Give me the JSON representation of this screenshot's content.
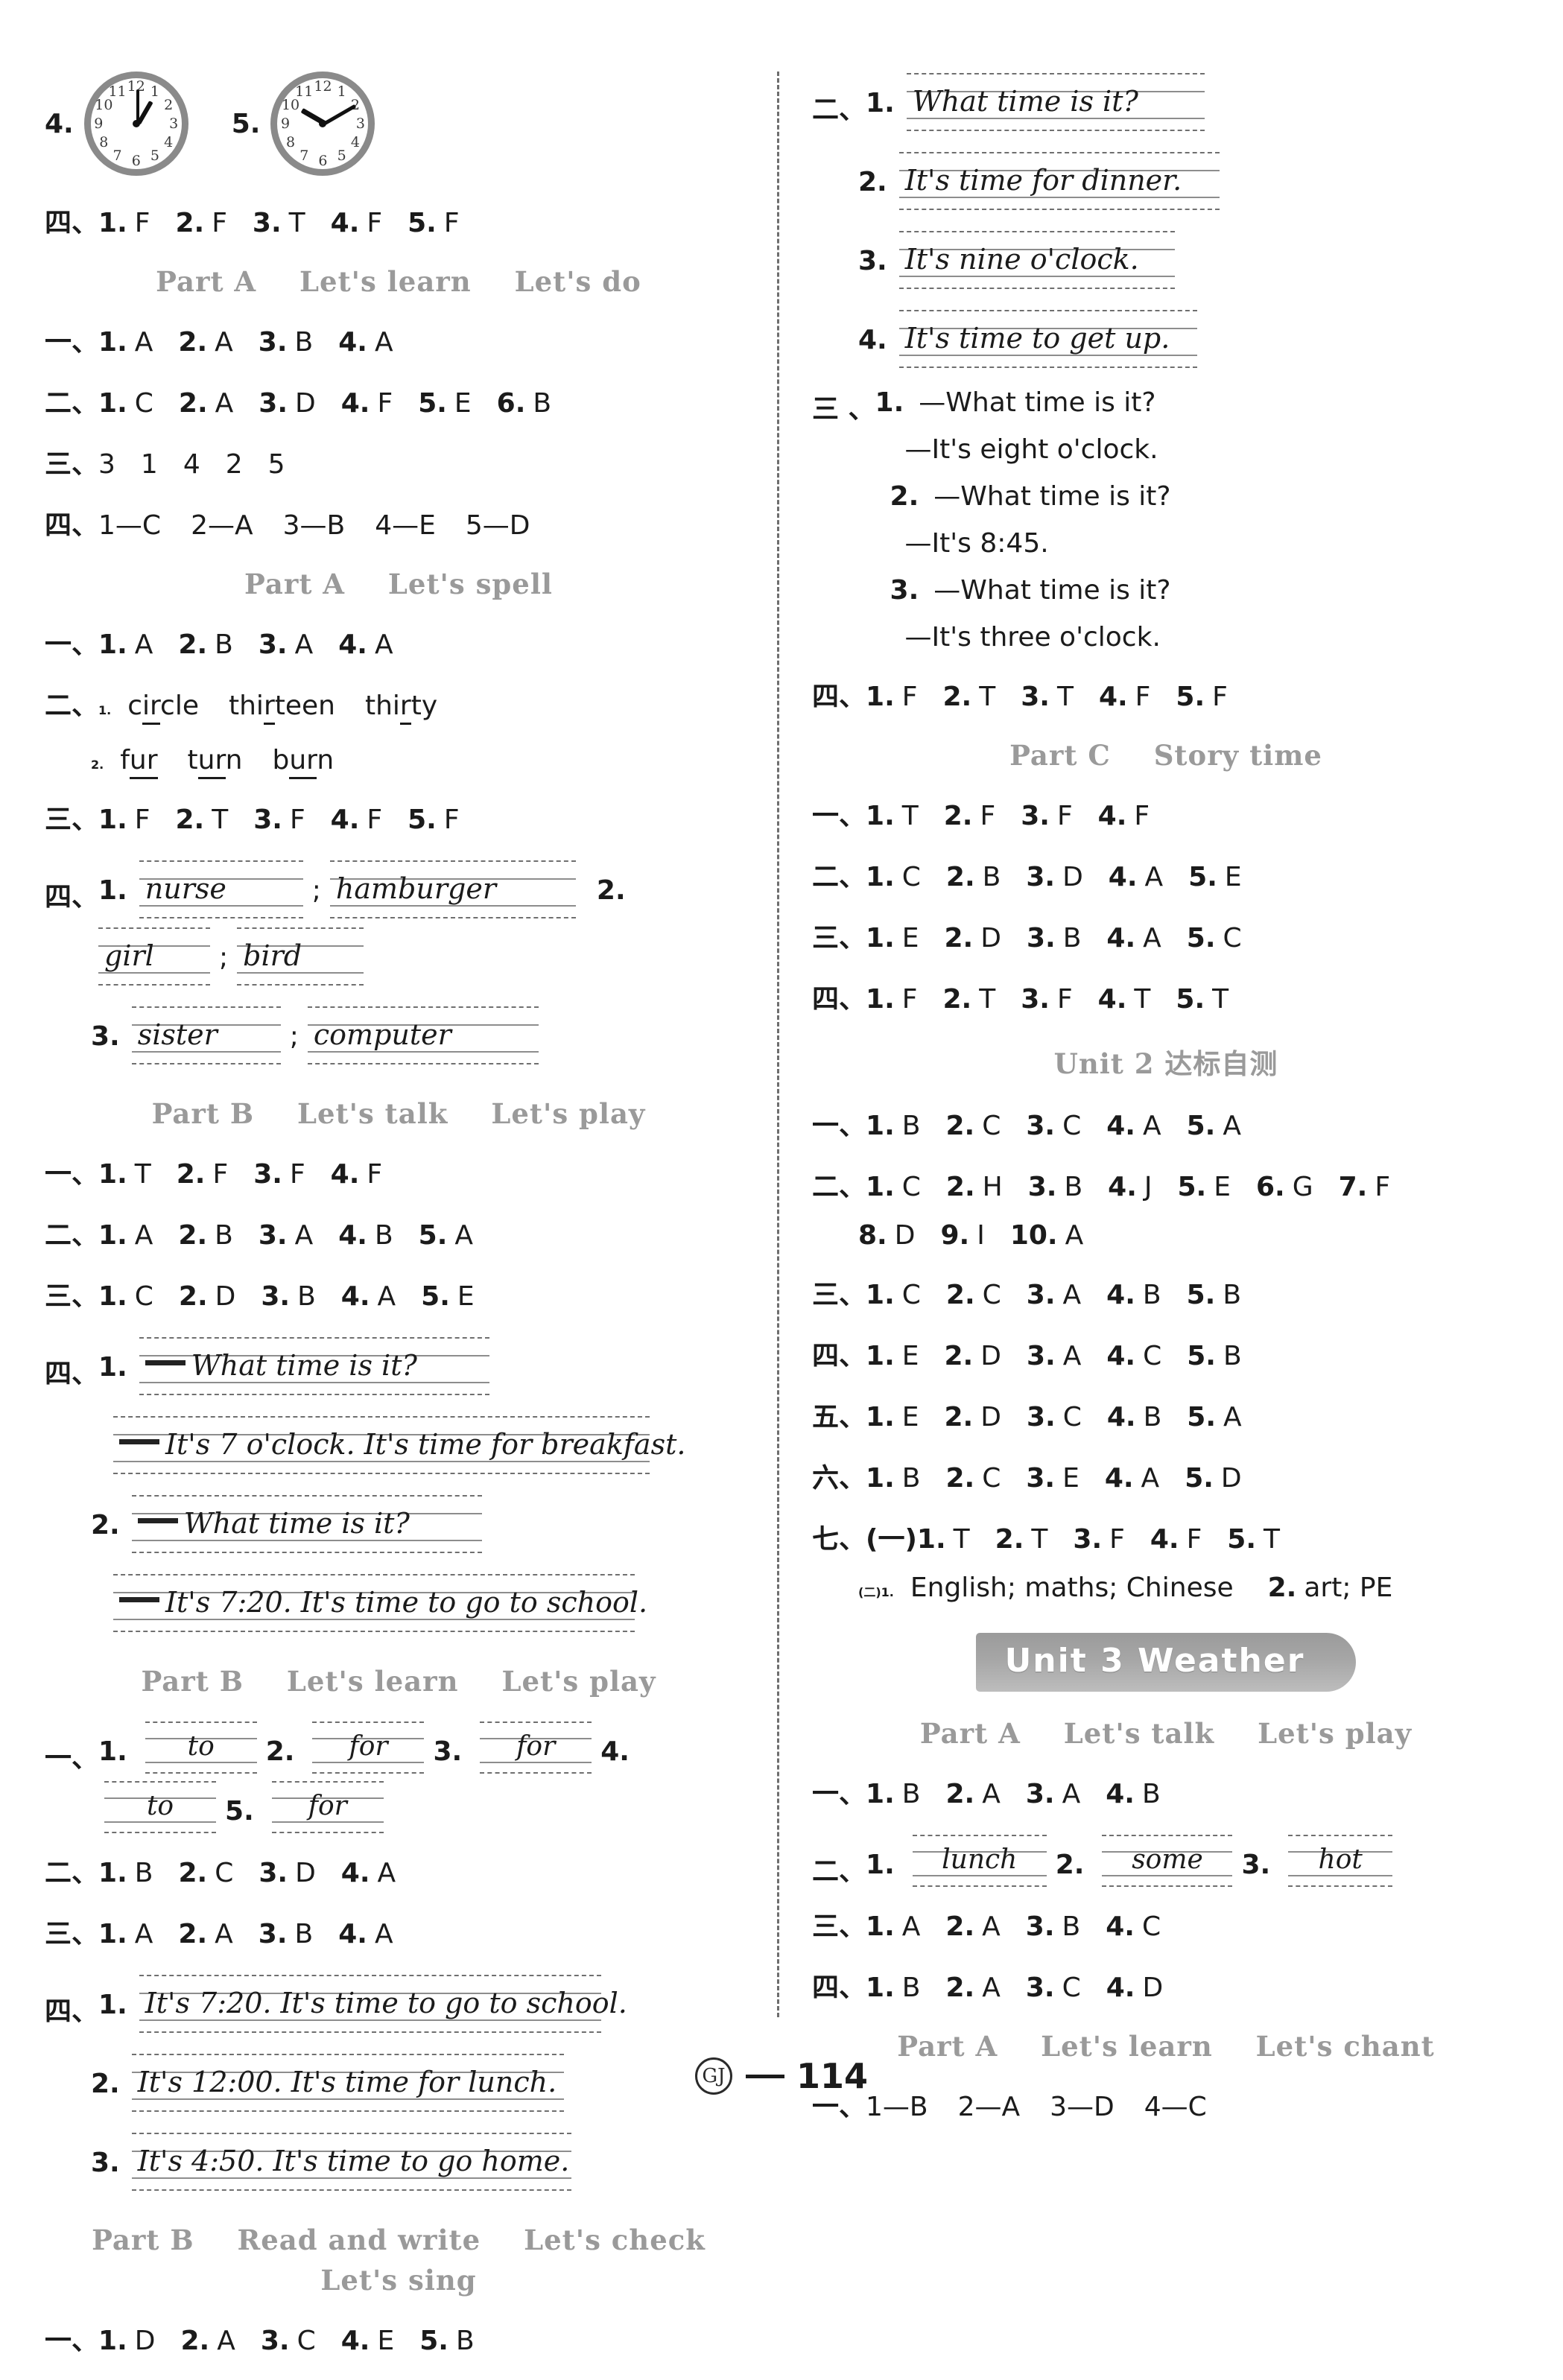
{
  "page": {
    "number": "114",
    "logo_text": "GJ"
  },
  "clocks": {
    "label_4": "4.",
    "label_5": "5.",
    "numerals": [
      "12",
      "1",
      "2",
      "3",
      "4",
      "5",
      "6",
      "7",
      "8",
      "9",
      "10",
      "11"
    ],
    "clock4_time": "1:00",
    "clock5_time": "10:10"
  },
  "left": {
    "rows": [
      {
        "cnum": "四、",
        "items": [
          {
            "q": "1.",
            "a": "F"
          },
          {
            "q": "2.",
            "a": "F"
          },
          {
            "q": "3.",
            "a": "T"
          },
          {
            "q": "4.",
            "a": "F"
          },
          {
            "q": "5.",
            "a": "F"
          }
        ]
      }
    ],
    "sect_a_learn": {
      "part": "Part A",
      "t1": "Let's learn",
      "t2": "Let's do"
    },
    "a_learn_rows": [
      {
        "cnum": "一、",
        "items": [
          {
            "q": "1.",
            "a": "A"
          },
          {
            "q": "2.",
            "a": "A"
          },
          {
            "q": "3.",
            "a": "B"
          },
          {
            "q": "4.",
            "a": "A"
          }
        ]
      },
      {
        "cnum": "二、",
        "items": [
          {
            "q": "1.",
            "a": "C"
          },
          {
            "q": "2.",
            "a": "A"
          },
          {
            "q": "3.",
            "a": "D"
          },
          {
            "q": "4.",
            "a": "F"
          },
          {
            "q": "5.",
            "a": "E"
          },
          {
            "q": "6.",
            "a": "B"
          }
        ]
      },
      {
        "cnum": "三、",
        "seq": [
          "3",
          "1",
          "4",
          "2",
          "5"
        ]
      },
      {
        "cnum": "四、",
        "matches": [
          "1—C",
          "2—A",
          "3—B",
          "4—E",
          "5—D"
        ]
      }
    ],
    "sect_a_spell": {
      "part": "Part A",
      "t1": "Let's spell"
    },
    "a_spell_rows": [
      {
        "cnum": "一、",
        "items": [
          {
            "q": "1.",
            "a": "A"
          },
          {
            "q": "2.",
            "a": "B"
          },
          {
            "q": "3.",
            "a": "A"
          },
          {
            "q": "4.",
            "a": "A"
          }
        ]
      }
    ],
    "spell_words": {
      "cnum": "二、",
      "line1_q": "1.",
      "line1": [
        {
          "pre": "c",
          "ul": "ir",
          "post": "cle"
        },
        {
          "pre": "thi",
          "ul": "r",
          "post": "teen"
        },
        {
          "pre": "thi",
          "ul": "r",
          "post": "ty"
        }
      ],
      "line2_q": "2.",
      "line2": [
        {
          "pre": "f",
          "ul": "ur",
          "post": ""
        },
        {
          "pre": "t",
          "ul": "ur",
          "post": "n"
        },
        {
          "pre": "b",
          "ul": "ur",
          "post": "n"
        }
      ]
    },
    "a_spell_rows2": [
      {
        "cnum": "三、",
        "items": [
          {
            "q": "1.",
            "a": "F"
          },
          {
            "q": "2.",
            "a": "T"
          },
          {
            "q": "3.",
            "a": "F"
          },
          {
            "q": "4.",
            "a": "F"
          },
          {
            "q": "5.",
            "a": "F"
          }
        ]
      }
    ],
    "spell_hw": {
      "cnum": "四、",
      "l1_q": "1.",
      "l1_a": "nurse",
      "l1_sep": ";",
      "l1_b": "hamburger",
      "l1_q2": "2.",
      "l1_c": "girl",
      "l1_sep2": ";",
      "l1_d": "bird",
      "l2_q": "3.",
      "l2_a": "sister",
      "l2_sep": ";",
      "l2_b": "computer"
    },
    "sect_b_talk": {
      "part": "Part B",
      "t1": "Let's talk",
      "t2": "Let's play"
    },
    "b_talk_rows": [
      {
        "cnum": "一、",
        "items": [
          {
            "q": "1.",
            "a": "T"
          },
          {
            "q": "2.",
            "a": "F"
          },
          {
            "q": "3.",
            "a": "F"
          },
          {
            "q": "4.",
            "a": "F"
          }
        ]
      },
      {
        "cnum": "二、",
        "items": [
          {
            "q": "1.",
            "a": "A"
          },
          {
            "q": "2.",
            "a": "B"
          },
          {
            "q": "3.",
            "a": "A"
          },
          {
            "q": "4.",
            "a": "B"
          },
          {
            "q": "5.",
            "a": "A"
          }
        ]
      },
      {
        "cnum": "三、",
        "items": [
          {
            "q": "1.",
            "a": "C"
          },
          {
            "q": "2.",
            "a": "D"
          },
          {
            "q": "3.",
            "a": "B"
          },
          {
            "q": "4.",
            "a": "A"
          },
          {
            "q": "5.",
            "a": "E"
          }
        ]
      }
    ],
    "b_talk_hw": {
      "cnum": "四、",
      "q1": "1.",
      "q1_l1": "What time is it?",
      "q1_l2": "It's 7 o'clock. It's time for breakfast.",
      "q2": "2.",
      "q2_l1": "What time is it?",
      "q2_l2": "It's 7:20. It's time to go to school."
    },
    "sect_b_learn": {
      "part": "Part B",
      "t1": "Let's learn",
      "t2": "Let's play"
    },
    "b_learn_blanks": {
      "cnum": "一、",
      "items": [
        {
          "q": "1.",
          "a": "to"
        },
        {
          "q": "2.",
          "a": "for"
        },
        {
          "q": "3.",
          "a": "for"
        },
        {
          "q": "4.",
          "a": "to"
        },
        {
          "q": "5.",
          "a": "for"
        }
      ]
    },
    "b_learn_rows": [
      {
        "cnum": "二、",
        "items": [
          {
            "q": "1.",
            "a": "B"
          },
          {
            "q": "2.",
            "a": "C"
          },
          {
            "q": "3.",
            "a": "D"
          },
          {
            "q": "4.",
            "a": "A"
          }
        ]
      },
      {
        "cnum": "三、",
        "items": [
          {
            "q": "1.",
            "a": "A"
          },
          {
            "q": "2.",
            "a": "A"
          },
          {
            "q": "3.",
            "a": "B"
          },
          {
            "q": "4.",
            "a": "A"
          }
        ]
      }
    ],
    "b_learn_hw": {
      "cnum": "四、",
      "q1": "1.",
      "l1": "It's 7:20. It's time to go to school.",
      "q2": "2.",
      "l2": "It's 12:00. It's time for lunch.",
      "q3": "3.",
      "l3": "It's 4:50. It's time to go home."
    },
    "sect_b_read": {
      "part": "Part B",
      "t1": "Read and write",
      "t2": "Let's check",
      "t3": "Let's sing"
    },
    "b_read_rows": [
      {
        "cnum": "一、",
        "items": [
          {
            "q": "1.",
            "a": "D"
          },
          {
            "q": "2.",
            "a": "A"
          },
          {
            "q": "3.",
            "a": "C"
          },
          {
            "q": "4.",
            "a": "E"
          },
          {
            "q": "5.",
            "a": "B"
          }
        ]
      }
    ]
  },
  "right": {
    "top_hw": {
      "cnum": "二、",
      "q1": "1.",
      "l1": "What time is it?",
      "q2": "2.",
      "l2": "It's time for dinner.",
      "q3": "3.",
      "l3": "It's nine o'clock.",
      "q4": "4.",
      "l4": "It's time to get up."
    },
    "dialogues": {
      "cnum": "三 、",
      "items": [
        {
          "q": "1.",
          "ask": "—What time is it?",
          "ans": "—It's eight o'clock."
        },
        {
          "q": "2.",
          "ask": "—What time is it?",
          "ans": "—It's 8:45."
        },
        {
          "q": "3.",
          "ask": "—What time is it?",
          "ans": "—It's three o'clock."
        }
      ]
    },
    "after_dialogue_rows": [
      {
        "cnum": "四、",
        "items": [
          {
            "q": "1.",
            "a": "F"
          },
          {
            "q": "2.",
            "a": "T"
          },
          {
            "q": "3.",
            "a": "T"
          },
          {
            "q": "4.",
            "a": "F"
          },
          {
            "q": "5.",
            "a": "F"
          }
        ]
      }
    ],
    "sect_c_story": {
      "part": "Part C",
      "t1": "Story time"
    },
    "c_story_rows": [
      {
        "cnum": "一、",
        "items": [
          {
            "q": "1.",
            "a": "T"
          },
          {
            "q": "2.",
            "a": "F"
          },
          {
            "q": "3.",
            "a": "F"
          },
          {
            "q": "4.",
            "a": "F"
          }
        ]
      },
      {
        "cnum": "二、",
        "items": [
          {
            "q": "1.",
            "a": "C"
          },
          {
            "q": "2.",
            "a": "B"
          },
          {
            "q": "3.",
            "a": "D"
          },
          {
            "q": "4.",
            "a": "A"
          },
          {
            "q": "5.",
            "a": "E"
          }
        ]
      },
      {
        "cnum": "三、",
        "items": [
          {
            "q": "1.",
            "a": "E"
          },
          {
            "q": "2.",
            "a": "D"
          },
          {
            "q": "3.",
            "a": "B"
          },
          {
            "q": "4.",
            "a": "A"
          },
          {
            "q": "5.",
            "a": "C"
          }
        ]
      },
      {
        "cnum": "四、",
        "items": [
          {
            "q": "1.",
            "a": "F"
          },
          {
            "q": "2.",
            "a": "T"
          },
          {
            "q": "3.",
            "a": "F"
          },
          {
            "q": "4.",
            "a": "T"
          },
          {
            "q": "5.",
            "a": "T"
          }
        ]
      }
    ],
    "unit2_header": "Unit 2 达标自测",
    "unit2_rows": [
      {
        "cnum": "一、",
        "items": [
          {
            "q": "1.",
            "a": "B"
          },
          {
            "q": "2.",
            "a": "C"
          },
          {
            "q": "3.",
            "a": "C"
          },
          {
            "q": "4.",
            "a": "A"
          },
          {
            "q": "5.",
            "a": "A"
          }
        ]
      },
      {
        "cnum": "二、",
        "items": [
          {
            "q": "1.",
            "a": "C"
          },
          {
            "q": "2.",
            "a": "H"
          },
          {
            "q": "3.",
            "a": "B"
          },
          {
            "q": "4.",
            "a": "J"
          },
          {
            "q": "5.",
            "a": "E"
          },
          {
            "q": "6.",
            "a": "G"
          },
          {
            "q": "7.",
            "a": "F"
          }
        ]
      }
    ],
    "unit2_row2_cont": {
      "items": [
        {
          "q": "8.",
          "a": "D"
        },
        {
          "q": "9.",
          "a": "I"
        },
        {
          "q": "10.",
          "a": "A"
        }
      ]
    },
    "unit2_rows_b": [
      {
        "cnum": "三、",
        "items": [
          {
            "q": "1.",
            "a": "C"
          },
          {
            "q": "2.",
            "a": "C"
          },
          {
            "q": "3.",
            "a": "A"
          },
          {
            "q": "4.",
            "a": "B"
          },
          {
            "q": "5.",
            "a": "B"
          }
        ]
      },
      {
        "cnum": "四、",
        "items": [
          {
            "q": "1.",
            "a": "E"
          },
          {
            "q": "2.",
            "a": "D"
          },
          {
            "q": "3.",
            "a": "A"
          },
          {
            "q": "4.",
            "a": "C"
          },
          {
            "q": "5.",
            "a": "B"
          }
        ]
      },
      {
        "cnum": "五、",
        "items": [
          {
            "q": "1.",
            "a": "E"
          },
          {
            "q": "2.",
            "a": "D"
          },
          {
            "q": "3.",
            "a": "C"
          },
          {
            "q": "4.",
            "a": "B"
          },
          {
            "q": "5.",
            "a": "A"
          }
        ]
      },
      {
        "cnum": "六、",
        "items": [
          {
            "q": "1.",
            "a": "B"
          },
          {
            "q": "2.",
            "a": "C"
          },
          {
            "q": "3.",
            "a": "E"
          },
          {
            "q": "4.",
            "a": "A"
          },
          {
            "q": "5.",
            "a": "D"
          }
        ]
      }
    ],
    "unit2_seven": {
      "cnum": "七、(一)",
      "items": [
        {
          "q": "1.",
          "a": "T"
        },
        {
          "q": "2.",
          "a": "T"
        },
        {
          "q": "3.",
          "a": "F"
        },
        {
          "q": "4.",
          "a": "F"
        },
        {
          "q": "5.",
          "a": "T"
        }
      ],
      "part2_label": "(二)1.",
      "part2_a": "English; maths; Chinese",
      "part2_q2": "2.",
      "part2_b": "art; PE"
    },
    "unit3_banner": "Unit 3  Weather",
    "sect_u3_talk": {
      "part": "Part A",
      "t1": "Let's talk",
      "t2": "Let's play"
    },
    "u3_rows": [
      {
        "cnum": "一、",
        "items": [
          {
            "q": "1.",
            "a": "B"
          },
          {
            "q": "2.",
            "a": "A"
          },
          {
            "q": "3.",
            "a": "A"
          },
          {
            "q": "4.",
            "a": "B"
          }
        ]
      }
    ],
    "u3_blanks": {
      "cnum": "二、",
      "items": [
        {
          "q": "1.",
          "a": "lunch"
        },
        {
          "q": "2.",
          "a": "some"
        },
        {
          "q": "3.",
          "a": "hot"
        }
      ]
    },
    "u3_rows2": [
      {
        "cnum": "三、",
        "items": [
          {
            "q": "1.",
            "a": "A"
          },
          {
            "q": "2.",
            "a": "A"
          },
          {
            "q": "3.",
            "a": "B"
          },
          {
            "q": "4.",
            "a": "C"
          }
        ]
      },
      {
        "cnum": "四、",
        "items": [
          {
            "q": "1.",
            "a": "B"
          },
          {
            "q": "2.",
            "a": "A"
          },
          {
            "q": "3.",
            "a": "C"
          },
          {
            "q": "4.",
            "a": "D"
          }
        ]
      }
    ],
    "sect_u3_learn": {
      "part": "Part A",
      "t1": "Let's learn",
      "t2": "Let's chant"
    },
    "u3_last": {
      "cnum": "一、",
      "matches": [
        "1—B",
        "2—A",
        "3—D",
        "4—C"
      ]
    }
  }
}
